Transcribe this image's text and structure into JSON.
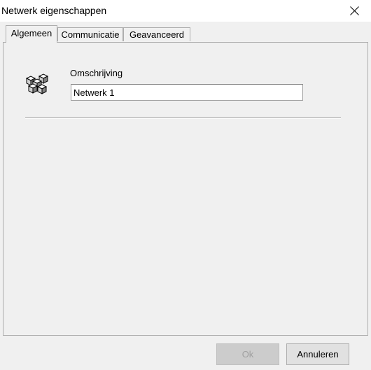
{
  "window": {
    "title": "Netwerk eigenschappen",
    "close_icon": "close-icon"
  },
  "tabs": [
    {
      "label": "Algemeen",
      "selected": true
    },
    {
      "label": "Communicatie",
      "selected": false
    },
    {
      "label": "Geavanceerd",
      "selected": false
    }
  ],
  "general": {
    "icon": "network-icon",
    "description_label": "Omschrijving",
    "description_value": "Netwerk 1"
  },
  "buttons": {
    "ok_label": "Ok",
    "ok_enabled": false,
    "cancel_label": "Annuleren"
  },
  "colors": {
    "window_bg": "#f0f0f0",
    "titlebar_bg": "#ffffff",
    "disabled_text": "#a0a0a0"
  }
}
